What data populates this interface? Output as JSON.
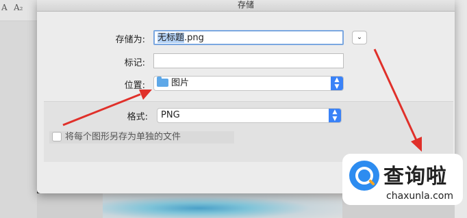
{
  "background": {
    "toolbar_glyph_a": "A",
    "toolbar_glyph_b": "A₂"
  },
  "dialog": {
    "title": "存储",
    "save_as_label": "存储为:",
    "filename_selected": "无标题",
    "filename_ext": ".png",
    "tags_label": "标记:",
    "tags_value": "",
    "location_label": "位置:",
    "location_value": "图片",
    "expand_icon": "chevron-down-icon",
    "format_label": "格式:",
    "format_value": "PNG",
    "checkbox_label": "将每个图形另存为单独的文件",
    "checkbox_checked": false
  },
  "watermark": {
    "title": "查询啦",
    "url": "chaxunla.com"
  },
  "colors": {
    "accent": "#3a82f7",
    "arrow": "#e0302a",
    "selection": "#b5d3f7"
  }
}
